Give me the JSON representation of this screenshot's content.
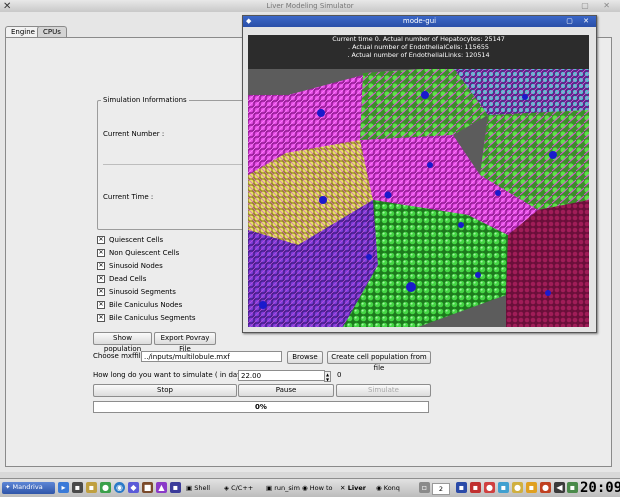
{
  "titlebar": {
    "title": "Liver Modeling Simulator"
  },
  "tabs": [
    {
      "label": "Engine"
    },
    {
      "label": "CPUs"
    }
  ],
  "sim_info": {
    "title": "Simulation Informations",
    "current_number_label": "Current Number :",
    "current_time_label": "Current Time :"
  },
  "checkboxes": [
    {
      "label": "Quiescent Cells",
      "checked": true
    },
    {
      "label": "Non Quiescent Cells",
      "checked": true
    },
    {
      "label": "Sinusoid Nodes",
      "checked": true
    },
    {
      "label": "Dead Cells",
      "checked": true
    },
    {
      "label": "Sinusoid Segments",
      "checked": true
    },
    {
      "label": "Bile Caniculus Nodes",
      "checked": true
    },
    {
      "label": "Bile Caniculus Segments",
      "checked": true
    }
  ],
  "buttons": {
    "show_population": "Show population",
    "export_povray": "Export Povray File",
    "browse": "Browse",
    "create_population": "Create cell population from file",
    "stop": "Stop",
    "pause": "Pause",
    "simulate": "Simulate"
  },
  "mxf": {
    "label": "Choose mxffile :",
    "value": "../inputs/multilobule.mxf"
  },
  "duration": {
    "label": "How long do you want to simulate ( in days )",
    "value": "22.00",
    "suffix": "0"
  },
  "progress": {
    "value": 0.0,
    "text": "0%"
  },
  "gui_window": {
    "title": "mode-gui",
    "hud_lines": [
      "Current time 0. Actual number of Hepatocytes: 25147",
      ". Actual number of EndothelialCells: 115655",
      ". Actual number of EndothelialLinks: 120514"
    ]
  },
  "taskbar": {
    "start_label": "Mandriva",
    "items": [
      "Shell",
      "C/C++",
      "run_sim",
      "How to",
      "Liver",
      "Konq"
    ],
    "desktop_number": "2",
    "clock": "20:09"
  },
  "colors": {
    "accent": "#2a4fa8",
    "progress_fill": "#4a6fd0",
    "hud_bg": "#2c2c2c"
  }
}
